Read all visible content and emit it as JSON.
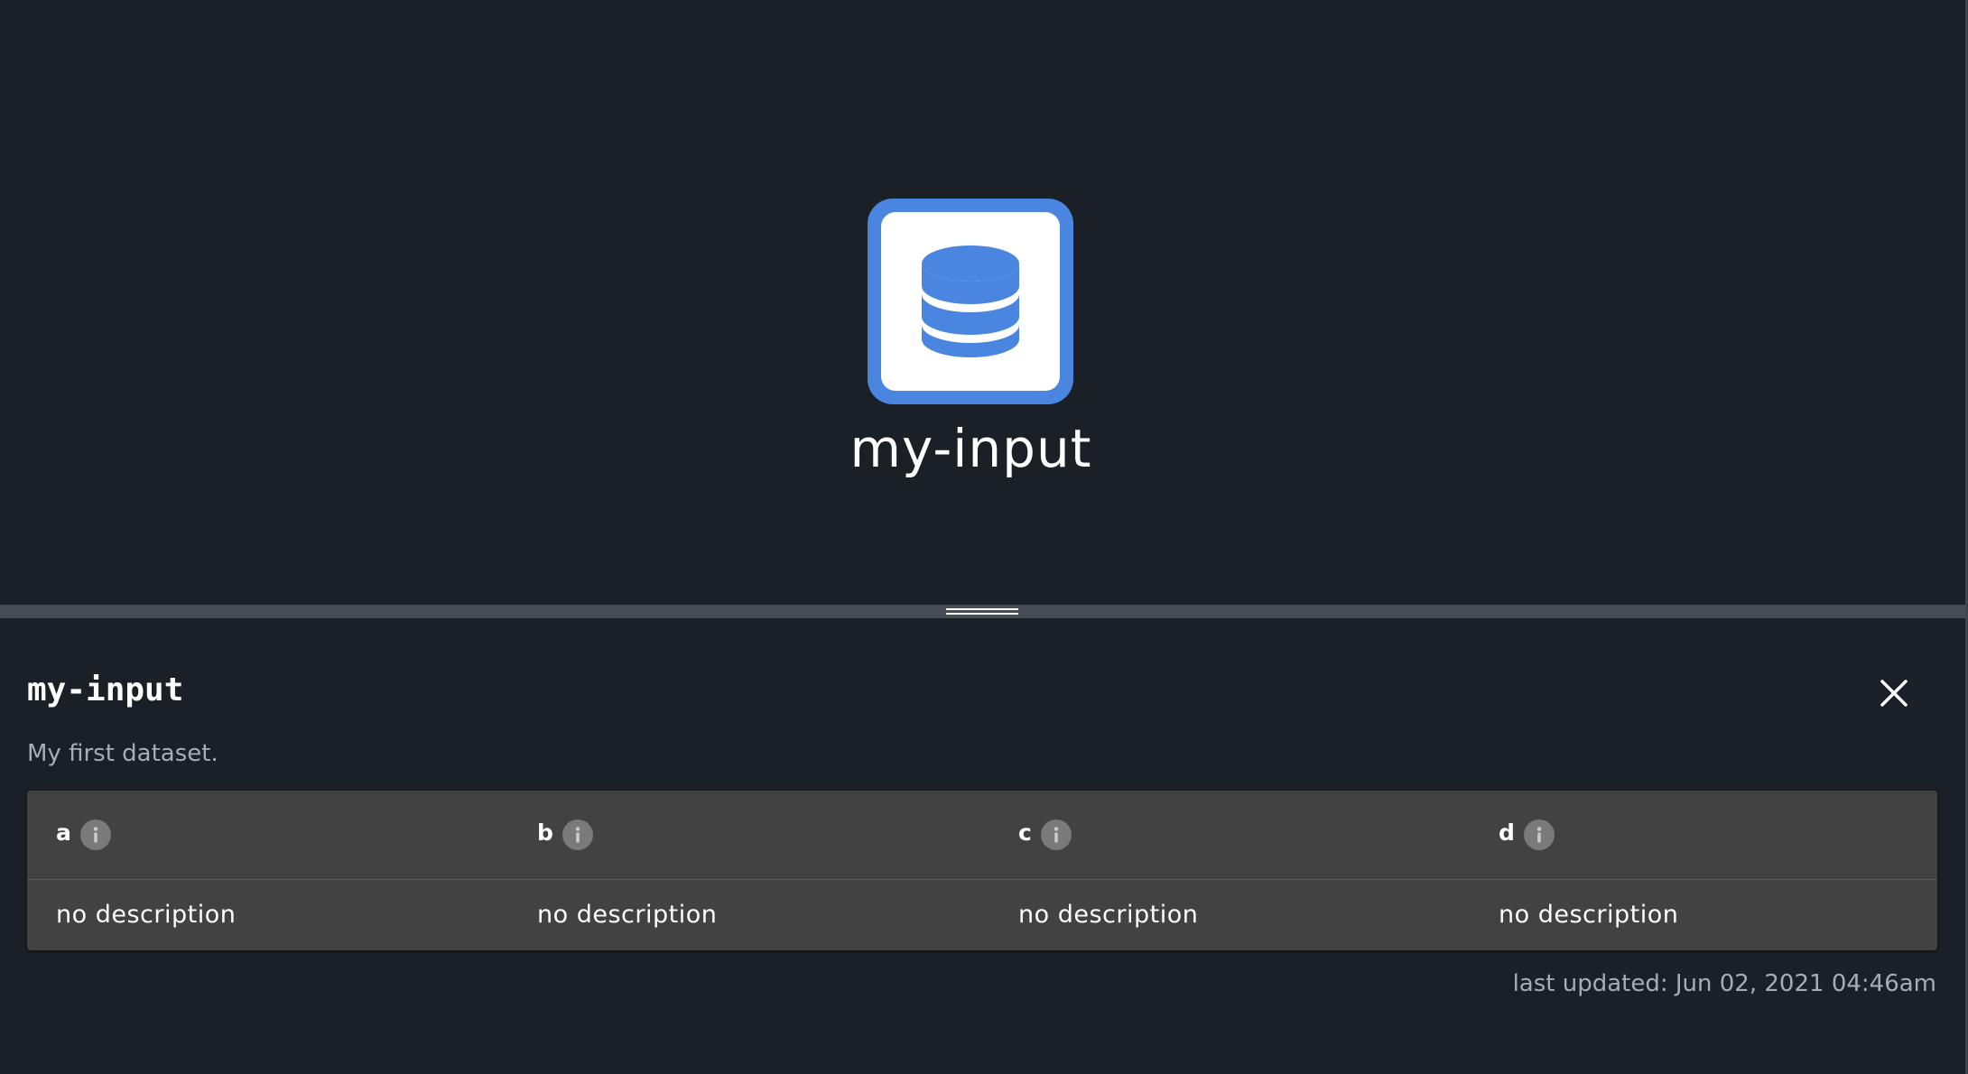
{
  "canvas": {
    "node": {
      "icon": "database-icon",
      "label": "my-input",
      "accent_color": "#4a86e0"
    }
  },
  "splitter": {
    "icon": "drag-handle-icon"
  },
  "detail": {
    "title": "my-input",
    "description": "My first dataset.",
    "close_icon": "close-icon",
    "columns": [
      {
        "name": "a",
        "description": "no description"
      },
      {
        "name": "b",
        "description": "no description"
      },
      {
        "name": "c",
        "description": "no description"
      },
      {
        "name": "d",
        "description": "no description"
      }
    ],
    "info_icon": "info-icon",
    "last_updated": "last updated: Jun 02, 2021 04:46am"
  }
}
